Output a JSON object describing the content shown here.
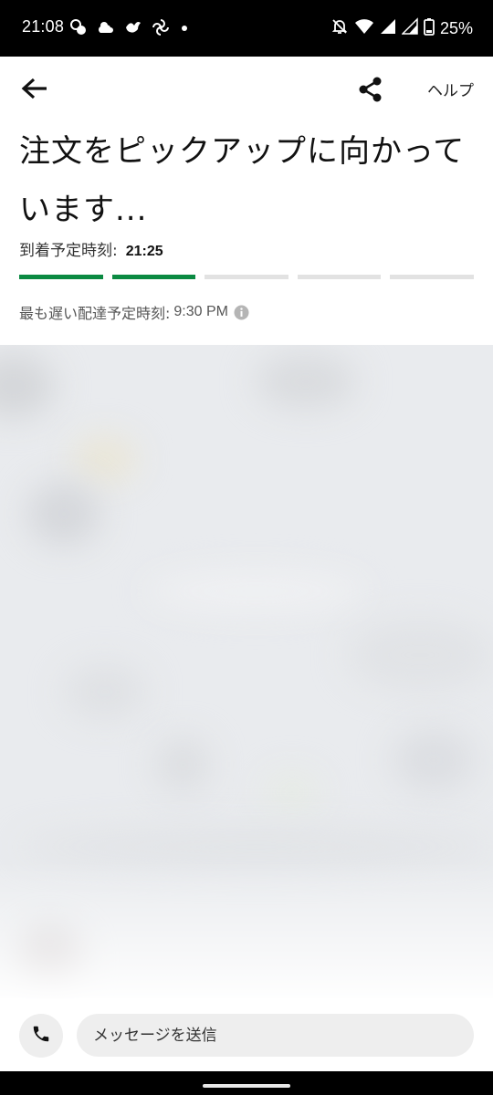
{
  "status_bar": {
    "time": "21:08",
    "battery": "25%",
    "notification_icons": [
      "chat-bubbles-icon",
      "weather-icon",
      "bird-icon",
      "pinwheel-icon",
      "dot-icon"
    ],
    "system_icons": [
      "bell-off-icon",
      "wifi-icon",
      "signal-icon",
      "signal-icon",
      "battery-icon"
    ]
  },
  "header": {
    "back_icon": "arrow-left-icon",
    "share_icon": "share-icon",
    "help_label": "ヘルプ",
    "title": "注文をピックアップに向かっています...",
    "eta_label": "到着予定時刻:",
    "eta_value": "21:25",
    "progress": {
      "completed_steps": 2,
      "total_steps": 5,
      "active_color": "#0b8a42"
    },
    "latest_label": "最も遅い配達予定時刻:",
    "latest_value": "9:30 PM",
    "info_icon": "info-icon"
  },
  "map": {
    "state": "blurred"
  },
  "bottom_bar": {
    "call_icon": "phone-icon",
    "message_placeholder": "メッセージを送信"
  }
}
